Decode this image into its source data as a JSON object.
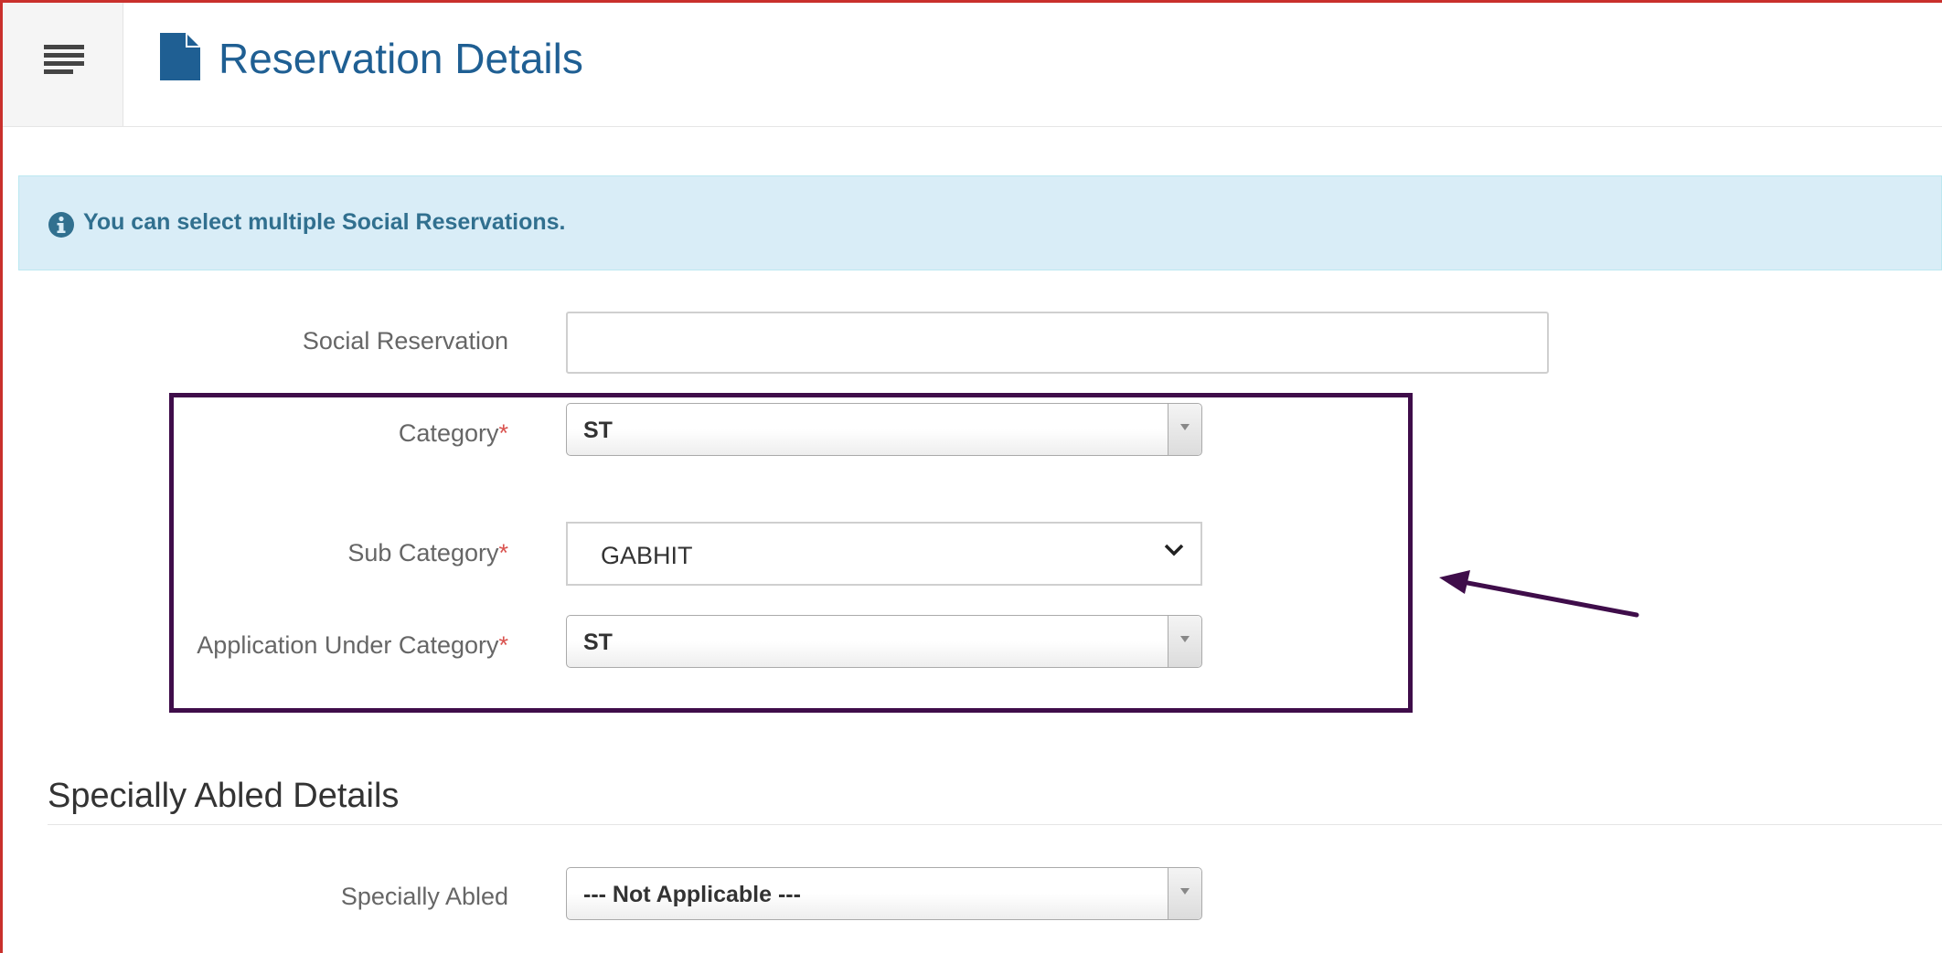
{
  "header": {
    "title": "Reservation Details",
    "menu_icon": "hamburger-icon",
    "title_icon": "file-icon"
  },
  "alert": {
    "icon": "info-circle-icon",
    "text": "You can select multiple Social Reservations."
  },
  "form": {
    "social_reservation": {
      "label": "Social Reservation",
      "value": ""
    },
    "category": {
      "label": "Category",
      "required_mark": "*",
      "value": "ST"
    },
    "sub_category": {
      "label": "Sub Category",
      "required_mark": "*",
      "value": "GABHIT"
    },
    "application_under_category": {
      "label": "Application Under Category",
      "required_mark": "*",
      "value": "ST"
    }
  },
  "specially_abled": {
    "section_title": "Specially Abled Details",
    "field": {
      "label": "Specially Abled",
      "value": "--- Not Applicable ---"
    }
  },
  "colors": {
    "title_blue": "#1f5f93",
    "alert_bg": "#d9edf7",
    "alert_text": "#31708f",
    "required_red": "#d9534f",
    "annotation_purple": "#3f0d4a",
    "frame_red": "#c9302c"
  }
}
